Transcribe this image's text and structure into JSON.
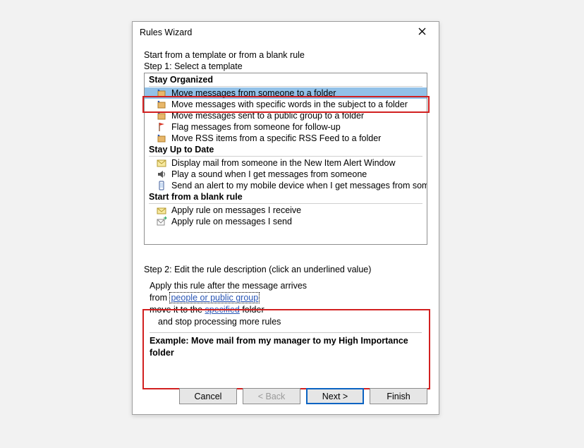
{
  "dialog": {
    "title": "Rules Wizard",
    "instruction": "Start from a template or from a blank rule",
    "step1_label": "Step 1: Select a template",
    "step2_label": "Step 2: Edit the rule description (click an underlined value)"
  },
  "groups": {
    "stay_organized": "Stay Organized",
    "stay_up_to_date": "Stay Up to Date",
    "blank": "Start from a blank rule"
  },
  "templates": {
    "move_from_someone": "Move messages from someone to a folder",
    "move_subject_words": "Move messages with specific words in the subject to a folder",
    "move_public_group": "Move messages sent to a public group to a folder",
    "flag_followup": "Flag messages from someone for follow-up",
    "move_rss": "Move RSS items from a specific RSS Feed to a folder",
    "display_alert": "Display mail from someone in the New Item Alert Window",
    "play_sound": "Play a sound when I get messages from someone",
    "send_mobile": "Send an alert to my mobile device when I get messages from someone",
    "apply_receive": "Apply rule on messages I receive",
    "apply_send": "Apply rule on messages I send"
  },
  "desc": {
    "line1": "Apply this rule after the message arrives",
    "line2_prefix": "from ",
    "line2_link": "people or public group",
    "line3_prefix": "move it to the ",
    "line3_link": "specified",
    "line3_suffix": " folder",
    "line4": "and stop processing more rules",
    "example": "Example: Move mail from my manager to my High Importance folder"
  },
  "buttons": {
    "cancel": "Cancel",
    "back": "< Back",
    "next": "Next >",
    "finish": "Finish"
  }
}
